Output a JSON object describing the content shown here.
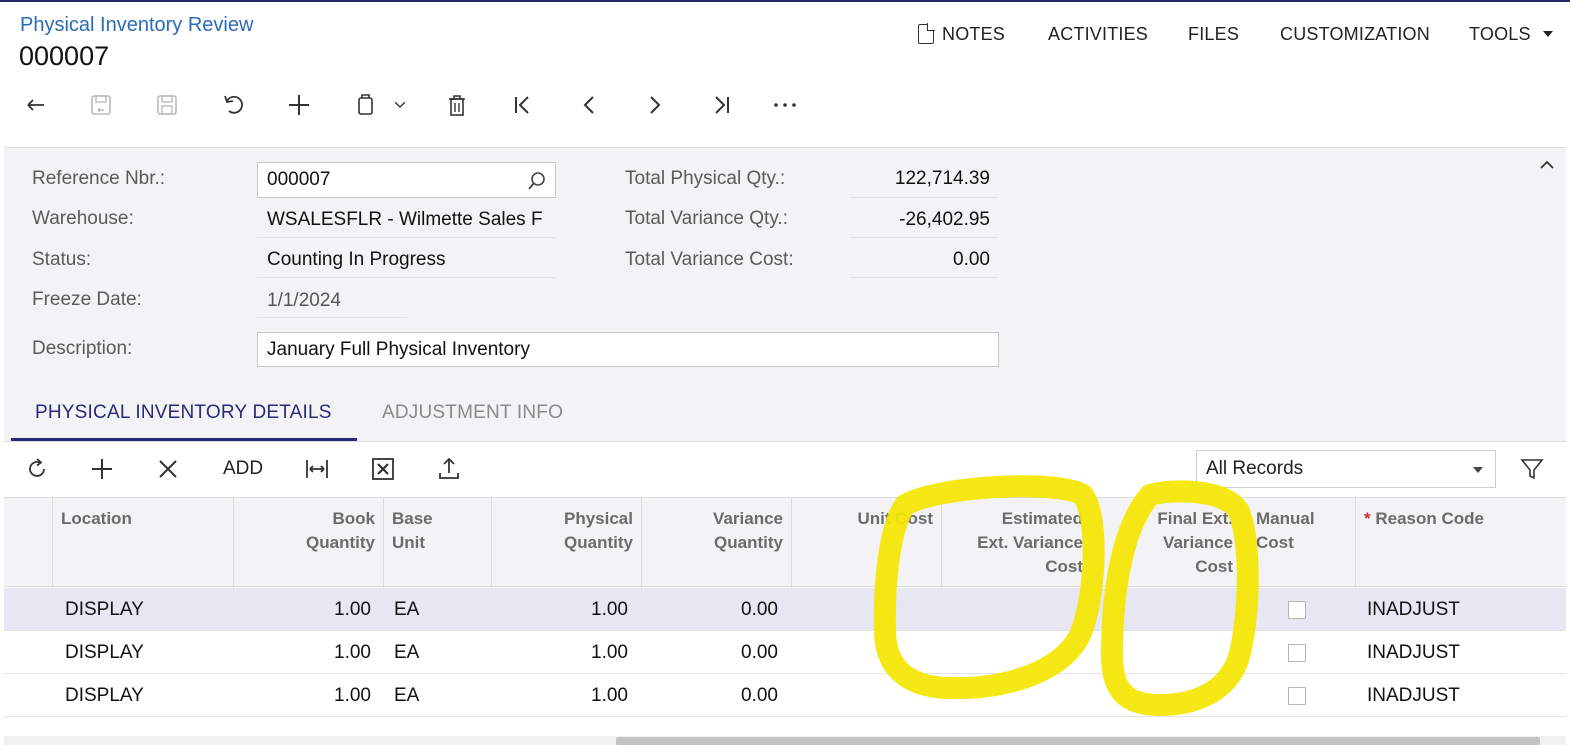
{
  "header": {
    "screen_title": "Physical Inventory Review",
    "reference": "000007"
  },
  "top_menu": {
    "notes": "NOTES",
    "activities": "ACTIVITIES",
    "files": "FILES",
    "customization": "CUSTOMIZATION",
    "tools": "TOOLS"
  },
  "form": {
    "reference_nbr": {
      "label": "Reference Nbr.:",
      "value": "000007"
    },
    "warehouse": {
      "label": "Warehouse:",
      "value": "WSALESFLR - Wilmette Sales F"
    },
    "status": {
      "label": "Status:",
      "value": "Counting In Progress"
    },
    "freeze_date": {
      "label": "Freeze Date:",
      "value": "1/1/2024"
    },
    "description": {
      "label": "Description:",
      "value": "January Full Physical Inventory"
    },
    "total_physical_qty": {
      "label": "Total Physical Qty.:",
      "value": "122,714.39"
    },
    "total_variance_qty": {
      "label": "Total Variance Qty.:",
      "value": "-26,402.95"
    },
    "total_variance_cost": {
      "label": "Total Variance Cost:",
      "value": "0.00"
    }
  },
  "tabs": [
    {
      "label": "PHYSICAL INVENTORY DETAILS",
      "active": true
    },
    {
      "label": "ADJUSTMENT INFO",
      "active": false
    }
  ],
  "grid_toolbar": {
    "add_label": "ADD",
    "filter_select": "All Records"
  },
  "grid": {
    "columns": {
      "location": "Location",
      "book_qty_1": "Book",
      "book_qty_2": "Quantity",
      "base_unit_1": "Base",
      "base_unit_2": "Unit",
      "physical_qty_1": "Physical",
      "physical_qty_2": "Quantity",
      "variance_qty_1": "Variance",
      "variance_qty_2": "Quantity",
      "unit_cost": "Unit Cost",
      "est_ext_var_cost_1": "Estimated",
      "est_ext_var_cost_2": "Ext. Variance",
      "est_ext_var_cost_3": "Cost",
      "final_ext_var_cost_1": "Final Ext.",
      "final_ext_var_cost_2": "Variance",
      "final_ext_var_cost_3": "Cost",
      "manual_cost_1": "Manual",
      "manual_cost_2": "Cost",
      "reason_code_required": "*",
      "reason_code": "Reason Code"
    },
    "rows": [
      {
        "location": "DISPLAY",
        "book_qty": "1.00",
        "base_unit": "EA",
        "physical_qty": "1.00",
        "variance_qty": "0.00",
        "unit_cost": "",
        "est_cost": "",
        "final_cost": "",
        "manual_cost": false,
        "reason_code": "INADJUST"
      },
      {
        "location": "DISPLAY",
        "book_qty": "1.00",
        "base_unit": "EA",
        "physical_qty": "1.00",
        "variance_qty": "0.00",
        "unit_cost": "",
        "est_cost": "",
        "final_cost": "",
        "manual_cost": false,
        "reason_code": "INADJUST"
      },
      {
        "location": "DISPLAY",
        "book_qty": "1.00",
        "base_unit": "EA",
        "physical_qty": "1.00",
        "variance_qty": "0.00",
        "unit_cost": "",
        "est_cost": "",
        "final_cost": "",
        "manual_cost": false,
        "reason_code": "INADJUST"
      }
    ]
  },
  "colors": {
    "accent": "#2a2a7a",
    "link": "#2a6ab8",
    "highlight_marker": "#f5e600",
    "selected_row": "#e7e7f3"
  }
}
